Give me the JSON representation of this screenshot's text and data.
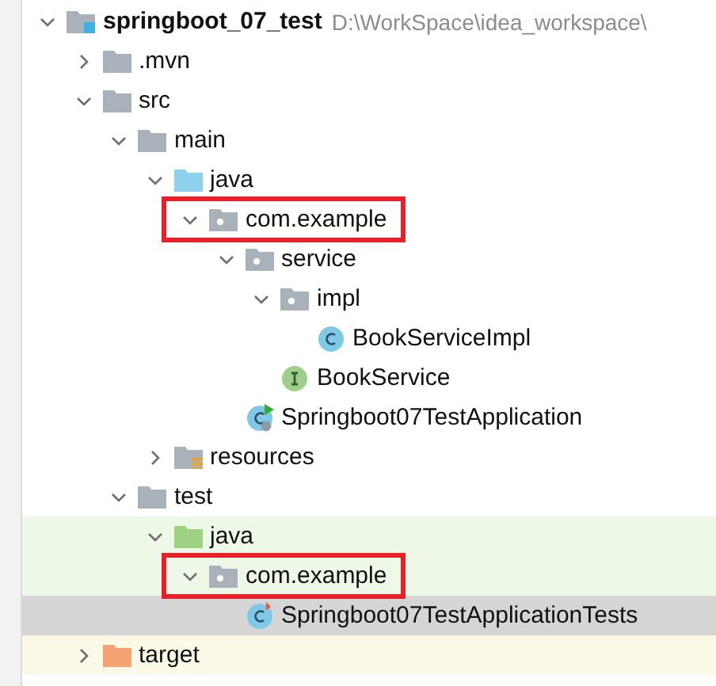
{
  "project_tree": [
    {
      "label": "springboot_07_test",
      "path": "D:\\WorkSpace\\idea_workspace\\",
      "kind": "module",
      "expanded": true,
      "selected": false,
      "boxed": false,
      "children": [
        {
          "label": ".mvn",
          "kind": "folder",
          "expanded": false,
          "selected": false,
          "boxed": false
        },
        {
          "label": "src",
          "kind": "folder",
          "expanded": true,
          "selected": false,
          "boxed": false,
          "children": [
            {
              "label": "main",
              "kind": "folder",
              "expanded": true,
              "selected": false,
              "boxed": false,
              "children": [
                {
                  "label": "java",
                  "kind": "source-folder",
                  "expanded": true,
                  "selected": false,
                  "boxed": false,
                  "children": [
                    {
                      "label": "com.example",
                      "kind": "package",
                      "expanded": true,
                      "selected": false,
                      "boxed": true,
                      "children": [
                        {
                          "label": "service",
                          "kind": "package",
                          "expanded": true,
                          "selected": false,
                          "boxed": false,
                          "children": [
                            {
                              "label": "impl",
                              "kind": "package",
                              "expanded": true,
                              "selected": false,
                              "boxed": false,
                              "children": [
                                {
                                  "label": "BookServiceImpl",
                                  "kind": "class",
                                  "selected": false,
                                  "boxed": false
                                }
                              ]
                            },
                            {
                              "label": "BookService",
                              "kind": "interface",
                              "selected": false,
                              "boxed": false
                            }
                          ]
                        },
                        {
                          "label": "Springboot07TestApplication",
                          "kind": "main-class",
                          "selected": false,
                          "boxed": false
                        }
                      ]
                    }
                  ]
                },
                {
                  "label": "resources",
                  "kind": "resources",
                  "expanded": false,
                  "selected": false,
                  "boxed": false
                }
              ]
            },
            {
              "label": "test",
              "kind": "folder",
              "expanded": true,
              "selected": false,
              "boxed": false,
              "children": [
                {
                  "label": "java",
                  "kind": "test-folder",
                  "expanded": true,
                  "selected": false,
                  "boxed": false,
                  "test_scope": true,
                  "children": [
                    {
                      "label": "com.example",
                      "kind": "package",
                      "expanded": true,
                      "selected": false,
                      "boxed": true,
                      "test_scope": true,
                      "children": [
                        {
                          "label": "Springboot07TestApplicationTests",
                          "kind": "test-class",
                          "selected": true,
                          "boxed": false
                        }
                      ]
                    }
                  ]
                }
              ]
            }
          ]
        },
        {
          "label": "target",
          "kind": "excluded-folder",
          "expanded": false,
          "selected": false,
          "boxed": false
        }
      ]
    }
  ]
}
